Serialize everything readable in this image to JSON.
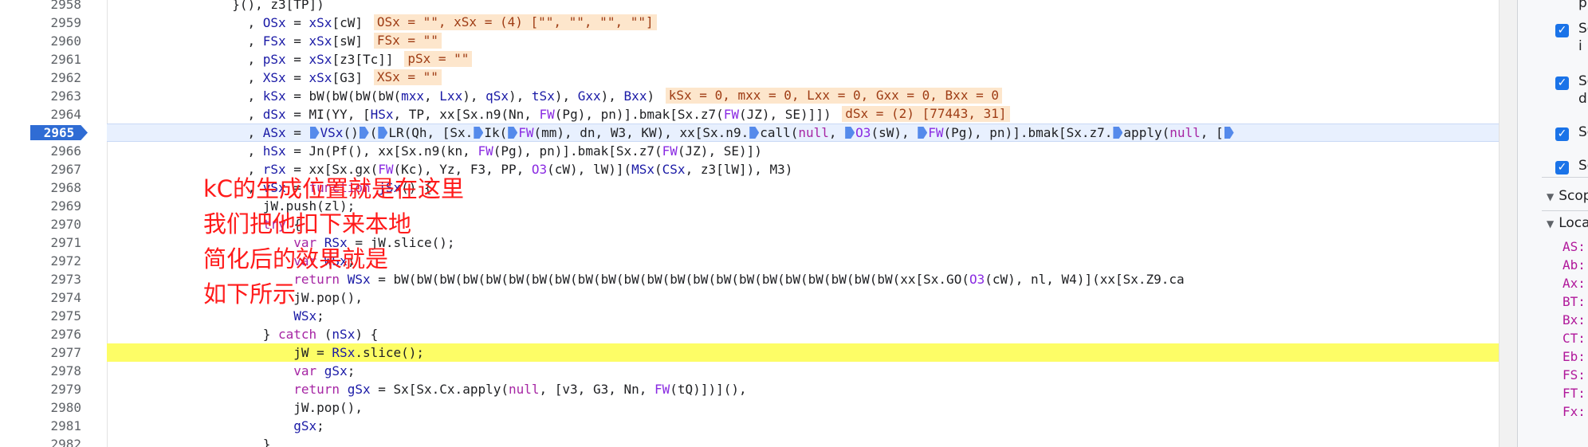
{
  "lines": [
    {
      "n": "2958",
      "t": "top",
      "code": "                        }(), z3[TP])"
    },
    {
      "n": "2959",
      "code": "                          , OSx = xSx[cW]",
      "inline": "OSx = \"\", xSx = (4) [\"\", \"\", \"\", \"\"]"
    },
    {
      "n": "2960",
      "code": "                          , FSx = xSx[sW]",
      "inline": "FSx = \"\""
    },
    {
      "n": "2961",
      "code": "                          , pSx = xSx[z3[Tc]]",
      "inline": "pSx = \"\""
    },
    {
      "n": "2962",
      "code": "                          , XSx = xSx[G3]",
      "inline": "XSx = \"\""
    },
    {
      "n": "2963",
      "code": "                          , kSx = bW(bW(bW(bW(mxx, Lxx), qSx), tSx), Gxx), Bxx)",
      "inline": "kSx = 0, mxx = 0, Lxx = 0, Gxx = 0, Bxx = 0"
    },
    {
      "n": "2964",
      "code": "                          , dSx = MI(YY, [HSx, TP, xx[Sx.n9(Nn, FW(Pg), pn)].bmak[Sx.z7(FW(JZ), SE)]])",
      "inline": "dSx = (2) [77443, 31]"
    },
    {
      "n": "2965",
      "code": "                          , ASx = ",
      "rest": "VSx()",
      "rest2": "(",
      "rest3": "LR(Qh, [Sx.",
      "rest4": "Ik(",
      "rest5": "FW(mm), dn, W3, KW), xx[Sx.n9.",
      "rest6": "call(null, ",
      "rest7": "O3(sW), ",
      "rest8": "FW(Pg), pn)].bmak[Sx.z7.",
      "rest9": "apply(null, [",
      "current": true
    },
    {
      "n": "2966",
      "code": "                          , hSx = Jn(Pf(), xx[Sx.n9(kn, FW(Pg), pn)].bmak[Sx.z7(FW(JZ), SE)])"
    },
    {
      "n": "2967",
      "code": "                          , rSx = xx[Sx.gx(FW(Kc), Yz, F3, PP, O3(cW), lW)](MSx(CSx, z3[lW]), M3)"
    },
    {
      "n": "2968",
      "code": "                          , vSx = function jSx() {"
    },
    {
      "n": "2969",
      "code": "                            jW.push(zl);"
    },
    {
      "n": "2970",
      "code": "                            try {"
    },
    {
      "n": "2971",
      "code": "                                var RSx = jW.slice();"
    },
    {
      "n": "2972",
      "code": "                                var WSx;"
    },
    {
      "n": "2973",
      "code": "                                return WSx = bW(bW(bW(bW(bW(bW(bW(bW(bW(bW(bW(bW(bW(bW(bW(bW(bW(bW(bW(bW(bW(bW(xx[Sx.GO(O3(cW), nl, W4)](xx[Sx.Z9.ca"
    },
    {
      "n": "2974",
      "code": "                                jW.pop(),"
    },
    {
      "n": "2975",
      "code": "                                WSx;"
    },
    {
      "n": "2976",
      "code": "                            } catch (nSx) {"
    },
    {
      "n": "2977",
      "code": "                                jW = RSx.slice();",
      "highlight": true
    },
    {
      "n": "2978",
      "code": "                                var gSx;"
    },
    {
      "n": "2979",
      "code": "                                return gSx = Sx[Sx.Cx.apply(null, [v3, G3, Nn, FW(tQ)])](),"
    },
    {
      "n": "2980",
      "code": "                                jW.pop(),"
    },
    {
      "n": "2981",
      "code": "                                gSx;"
    },
    {
      "n": "2982",
      "code": "                            }"
    }
  ],
  "annotation": [
    "kC的生成位置就是在这里",
    "我们把他扣下来本地",
    "简化后的效果就是",
    "如下所示"
  ],
  "sidebar": {
    "top_text": "p",
    "checkboxes": [
      {
        "label": "Sc",
        "sub": "i"
      },
      {
        "label": "Sc",
        "sub": "d"
      },
      {
        "label": "Sc",
        "sub": ""
      },
      {
        "label": "Sc",
        "sub": ""
      }
    ],
    "scope_section": "Scop",
    "local_section": "Loca",
    "scope_items": [
      "AS:",
      "Ab:",
      "Ax:",
      "BT:",
      "Bx:",
      "CT:",
      "Eb:",
      "FS:",
      "FT:",
      "Fx:"
    ]
  }
}
